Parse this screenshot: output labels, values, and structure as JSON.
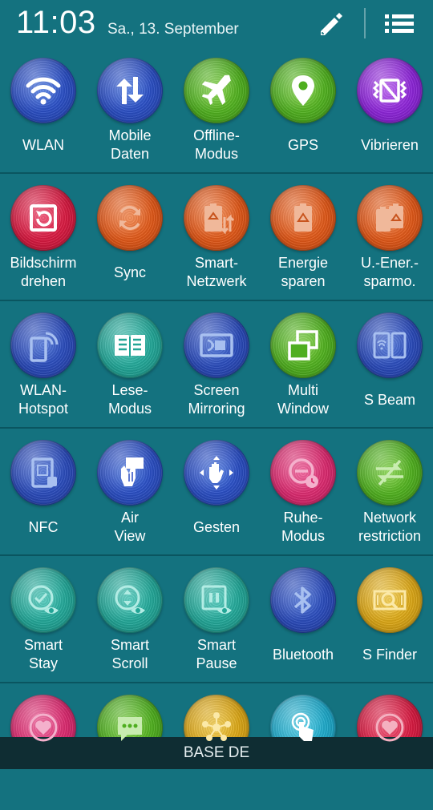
{
  "status": {
    "time": "11:03",
    "date": "Sa., 13. September"
  },
  "header": {
    "edit_icon": "pencil-icon",
    "list_icon": "list-icon"
  },
  "tiles": [
    {
      "label": "WLAN",
      "icon": "wifi-icon",
      "color": "#2b4fc4"
    },
    {
      "label": "Mobile\nDaten",
      "icon": "mobile-data-icon",
      "color": "#2b4fc4"
    },
    {
      "label": "Offline-\nModus",
      "icon": "airplane-icon",
      "color": "#4fae1f"
    },
    {
      "label": "GPS",
      "icon": "location-pin-icon",
      "color": "#4fae1f"
    },
    {
      "label": "Vibrieren",
      "icon": "vibrate-icon",
      "color": "#8c25d6"
    },
    {
      "label": "Bildschirm\ndrehen",
      "icon": "screen-rotation-icon",
      "color": "#d61a40"
    },
    {
      "label": "Sync",
      "icon": "sync-icon",
      "color": "#de5718"
    },
    {
      "label": "Smart-\nNetzwerk",
      "icon": "smart-network-battery-icon",
      "color": "#de5718"
    },
    {
      "label": "Energie\nsparen",
      "icon": "power-saving-icon",
      "color": "#de5718"
    },
    {
      "label": "U.-Ener.-\nsparmo.",
      "icon": "ultra-power-saving-icon",
      "color": "#de5718"
    },
    {
      "label": "WLAN-\nHotspot",
      "icon": "hotspot-icon",
      "color": "#2a4ab8"
    },
    {
      "label": "Lese-\nModus",
      "icon": "book-icon",
      "color": "#22a596"
    },
    {
      "label": "Screen\nMirroring",
      "icon": "screen-mirroring-icon",
      "color": "#2a4ab8"
    },
    {
      "label": "Multi\nWindow",
      "icon": "multi-window-icon",
      "color": "#4fae1f"
    },
    {
      "label": "S Beam",
      "icon": "s-beam-icon",
      "color": "#2a4ab8"
    },
    {
      "label": "NFC",
      "icon": "nfc-icon",
      "color": "#2a4ab8"
    },
    {
      "label": "Air\nView",
      "icon": "air-view-icon",
      "color": "#2b4fc4"
    },
    {
      "label": "Gesten",
      "icon": "gesture-hand-icon",
      "color": "#2b4fc4"
    },
    {
      "label": "Ruhe-\nModus",
      "icon": "do-not-disturb-icon",
      "color": "#d92a6e"
    },
    {
      "label": "Network\nrestriction",
      "icon": "network-restriction-icon",
      "color": "#4fae1f"
    },
    {
      "label": "Smart\nStay",
      "icon": "smart-stay-icon",
      "color": "#22a596"
    },
    {
      "label": "Smart\nScroll",
      "icon": "smart-scroll-icon",
      "color": "#22a596"
    },
    {
      "label": "Smart\nPause",
      "icon": "smart-pause-icon",
      "color": "#22a596"
    },
    {
      "label": "Bluetooth",
      "icon": "bluetooth-icon",
      "color": "#2a4ab8"
    },
    {
      "label": "S Finder",
      "icon": "s-finder-icon",
      "color": "#d9a516"
    },
    {
      "label": "",
      "icon": "heart-icon",
      "color": "#d92a6e"
    },
    {
      "label": "",
      "icon": "chat-bubble-icon",
      "color": "#4fae1f"
    },
    {
      "label": "",
      "icon": "share-icon",
      "color": "#d9a516"
    },
    {
      "label": "",
      "icon": "touch-icon",
      "color": "#1ea8c8"
    },
    {
      "label": "",
      "icon": "heart-icon",
      "color": "#d61a40"
    }
  ],
  "bottom": {
    "carrier": "BASE DE"
  }
}
